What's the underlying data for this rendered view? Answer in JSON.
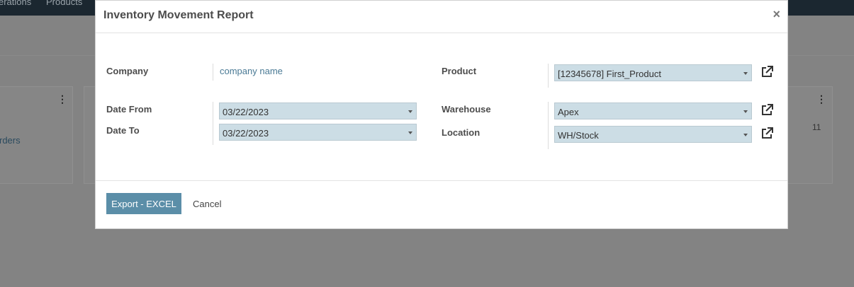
{
  "background": {
    "menu_items": [
      "erations",
      "Products"
    ],
    "card_left_text": "rders",
    "card_right_number": "11"
  },
  "dialog": {
    "title": "Inventory Movement Report",
    "close_glyph": "×",
    "fields": {
      "company_label": "Company",
      "company_value": "company name",
      "date_from_label": "Date From",
      "date_from_value": "03/22/2023",
      "date_to_label": "Date To",
      "date_to_value": "03/22/2023",
      "product_label": "Product",
      "product_value": "[12345678] First_Product",
      "warehouse_label": "Warehouse",
      "warehouse_value": "Apex",
      "location_label": "Location",
      "location_value": "WH/Stock"
    },
    "footer": {
      "export_label": "Export - EXCEL",
      "cancel_label": "Cancel"
    }
  },
  "colors": {
    "primary": "#5b8ea8",
    "field_bg": "#ccdde5",
    "link": "#4a7a95"
  },
  "icons": {
    "external_link": "external-link-icon",
    "dropdown": "caret-down-icon",
    "more": "vertical-dots-icon",
    "close": "close-icon"
  }
}
